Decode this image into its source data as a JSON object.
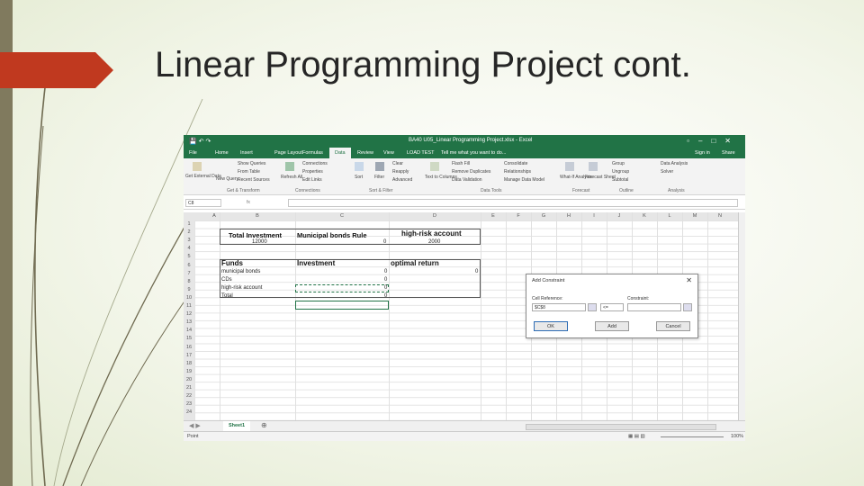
{
  "slide": {
    "title": "Linear Programming Project cont."
  },
  "excel": {
    "window_title": "BA40 U05_Linear Programming Project.xlsx - Excel",
    "menu_tabs": [
      "File",
      "Home",
      "Insert",
      "Page Layout",
      "Formulas",
      "Data",
      "Review",
      "View",
      "LOAD TEST",
      "Tell me what you want to do..."
    ],
    "active_tab": "Data",
    "sign_in": "Sign in",
    "share": "Share",
    "ribbon": {
      "get_external_data": "Get External Data",
      "new_query": "New Query",
      "show_queries": "Show Queries",
      "from_table": "From Table",
      "recent_sources": "Recent Sources",
      "refresh_all": "Refresh All",
      "connections": "Connections",
      "properties": "Properties",
      "edit_links": "Edit Links",
      "sort": "Sort",
      "filter": "Filter",
      "clear": "Clear",
      "reapply": "Reapply",
      "advanced": "Advanced",
      "text_to_columns": "Text to Columns",
      "flash_fill": "Flash Fill",
      "remove_duplicates": "Remove Duplicates",
      "data_validation": "Data Validation",
      "consolidate": "Consolidate",
      "relationships": "Relationships",
      "manage_data_model": "Manage Data Model",
      "what_if": "What-If Analysis",
      "forecast_sheet": "Forecast Sheet",
      "group": "Group",
      "ungroup": "Ungroup",
      "subtotal": "Subtotal",
      "data_analysis": "Data Analysis",
      "solver": "Solver",
      "groups": [
        "Get & Transform",
        "Connections",
        "Sort & Filter",
        "Data Tools",
        "Forecast",
        "Outline",
        "Analysis"
      ]
    },
    "name_box": "C8",
    "fx": "fx",
    "columns": [
      "A",
      "B",
      "C",
      "D",
      "E",
      "F",
      "G",
      "H",
      "I",
      "J",
      "K",
      "L",
      "M",
      "N"
    ],
    "rows": [
      "1",
      "2",
      "3",
      "4",
      "5",
      "6",
      "7",
      "8",
      "9",
      "10",
      "11",
      "12",
      "13",
      "14",
      "15",
      "16",
      "17",
      "18",
      "19",
      "20",
      "21",
      "22",
      "23",
      "24"
    ],
    "cells": {
      "total_investment_label": "Total Investment",
      "total_investment_value": "12000",
      "municipal_rule_label": "Municipal bonds Rule",
      "municipal_rule_value": "0",
      "high_risk_label": "high-risk account",
      "high_risk_value": "2000",
      "funds_header": "Funds",
      "investment_header": "Investment",
      "optimal_return_header": "optimal return",
      "fund_1": "municipal bonds",
      "fund_2": "CDs",
      "fund_3": "high-risk account",
      "fund_total": "Total",
      "inv_1": "0",
      "inv_2": "0",
      "inv_3": "0",
      "inv_total": "0",
      "optimal_value": "0"
    },
    "sheet_tab": "Sheet1",
    "status": "Point",
    "zoom": "100%",
    "dialog": {
      "title": "Add Constraint",
      "cell_reference_label": "Cell Reference:",
      "constraint_label": "Constraint:",
      "cell_reference_value": "$C$8",
      "operator": "<=",
      "ok": "OK",
      "add": "Add",
      "cancel": "Cancel"
    }
  },
  "colors": {
    "excel_green": "#217346",
    "title_arrow": "#c0391f",
    "left_stripe": "#807a5e"
  }
}
